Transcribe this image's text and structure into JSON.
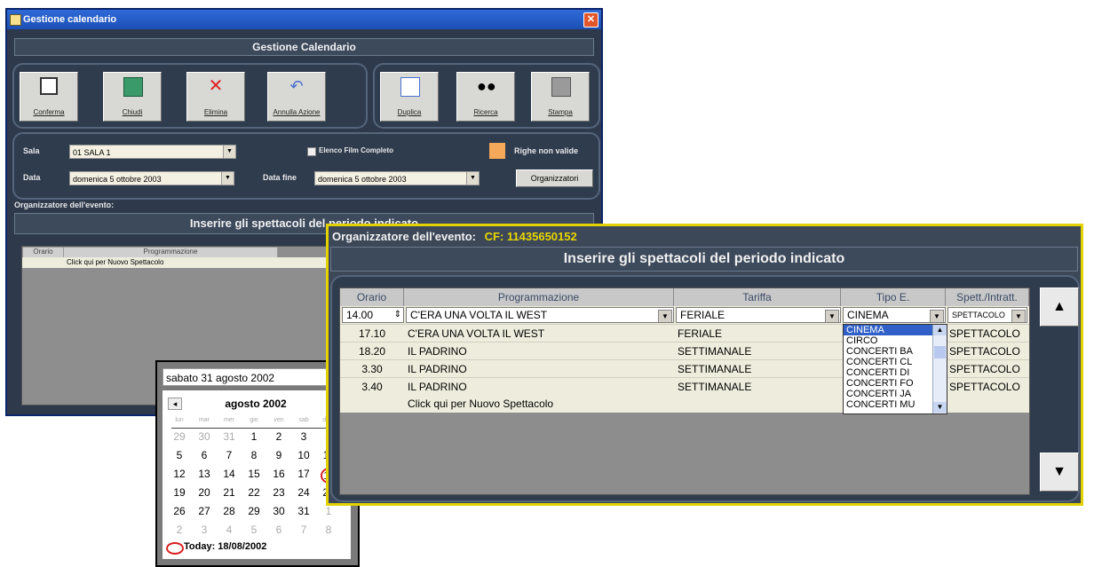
{
  "main_window": {
    "title": "Gestione calendario",
    "header": "Gestione Calendario",
    "toolbar": {
      "confirm": "Conferma",
      "close": "Chiudi",
      "delete": "Elimina",
      "undo": "Annulla Azione",
      "duplicate": "Duplica",
      "search": "Ricerca",
      "print": "Stampa"
    },
    "form": {
      "sala_label": "Sala",
      "sala_value": "01 SALA 1",
      "data_label": "Data",
      "data_value": "domenica  5   ottobre   2003",
      "data_fine_label": "Data fine",
      "data_fine_value": "domenica  5   ottobre   2003",
      "elenco_checkbox": "Elenco Film Completo",
      "righe_label": "Righe non valide",
      "organizzatori_button": "Organizzatori"
    },
    "organizer_label": "Organizzatore dell'evento:",
    "section_header": "Inserire gli spettacoli del periodo indicato",
    "grid_headers": [
      "Orario",
      "Programmazione"
    ],
    "new_row_text": "Click qui per Nuovo Spettacolo"
  },
  "calendar": {
    "selected": "sabato   31   agosto   2002",
    "month_title": "agosto 2002",
    "weekdays": [
      "lun",
      "mar",
      "mer",
      "gio",
      "ven",
      "sab",
      "dom"
    ],
    "weeks": [
      [
        "29",
        "30",
        "31",
        "1",
        "2",
        "3",
        "4"
      ],
      [
        "5",
        "6",
        "7",
        "8",
        "9",
        "10",
        "11"
      ],
      [
        "12",
        "13",
        "14",
        "15",
        "16",
        "17",
        "18"
      ],
      [
        "19",
        "20",
        "21",
        "22",
        "23",
        "24",
        "25"
      ],
      [
        "26",
        "27",
        "28",
        "29",
        "30",
        "31",
        "1"
      ],
      [
        "2",
        "3",
        "4",
        "5",
        "6",
        "7",
        "8"
      ]
    ],
    "today": "Today: 18/08/2002",
    "prev_glyph": "◂",
    "next_glyph": "▸"
  },
  "event_window": {
    "organizer_label": "Organizzatore dell'evento:",
    "organizer_cf": "CF: 11435650152",
    "section_header": "Inserire gli spettacoli del periodo indicato",
    "columns": [
      "Orario",
      "Programmazione",
      "Tariffa",
      "Tipo E.",
      "Spett./Intratt."
    ],
    "edit_row": {
      "orario": "14.00",
      "programmazione": "C'ERA UNA VOLTA IL WEST",
      "tariffa": "FERIALE",
      "tipo": "CINEMA",
      "spett": "SPETTACOLO"
    },
    "rows": [
      {
        "orario": "17.10",
        "programmazione": "C'ERA UNA VOLTA IL WEST",
        "tariffa": "FERIALE",
        "tipo": "",
        "spett": "SPETTACOLO"
      },
      {
        "orario": "18.20",
        "programmazione": "IL PADRINO",
        "tariffa": "SETTIMANALE",
        "tipo": "",
        "spett": "SPETTACOLO"
      },
      {
        "orario": "3.30",
        "programmazione": "IL PADRINO",
        "tariffa": "SETTIMANALE",
        "tipo": "",
        "spett": "SPETTACOLO"
      },
      {
        "orario": "3.40",
        "programmazione": "IL PADRINO",
        "tariffa": "SETTIMANALE",
        "tipo": "",
        "spett": "SPETTACOLO"
      }
    ],
    "new_row_text": "Click qui per Nuovo Spettacolo",
    "tipo_options": [
      "CINEMA",
      "CIRCO",
      "CONCERTI BA",
      "CONCERTI CL",
      "CONCERTI DI",
      "CONCERTI FO",
      "CONCERTI JA",
      "CONCERTI MU"
    ],
    "scroll_up": "▲",
    "scroll_down": "▼"
  },
  "colors": {
    "window_bg": "#2e3a4c",
    "highlight_border": "#e3d200",
    "selected_option": "#3160c8",
    "row_bg": "#eeeddd"
  }
}
